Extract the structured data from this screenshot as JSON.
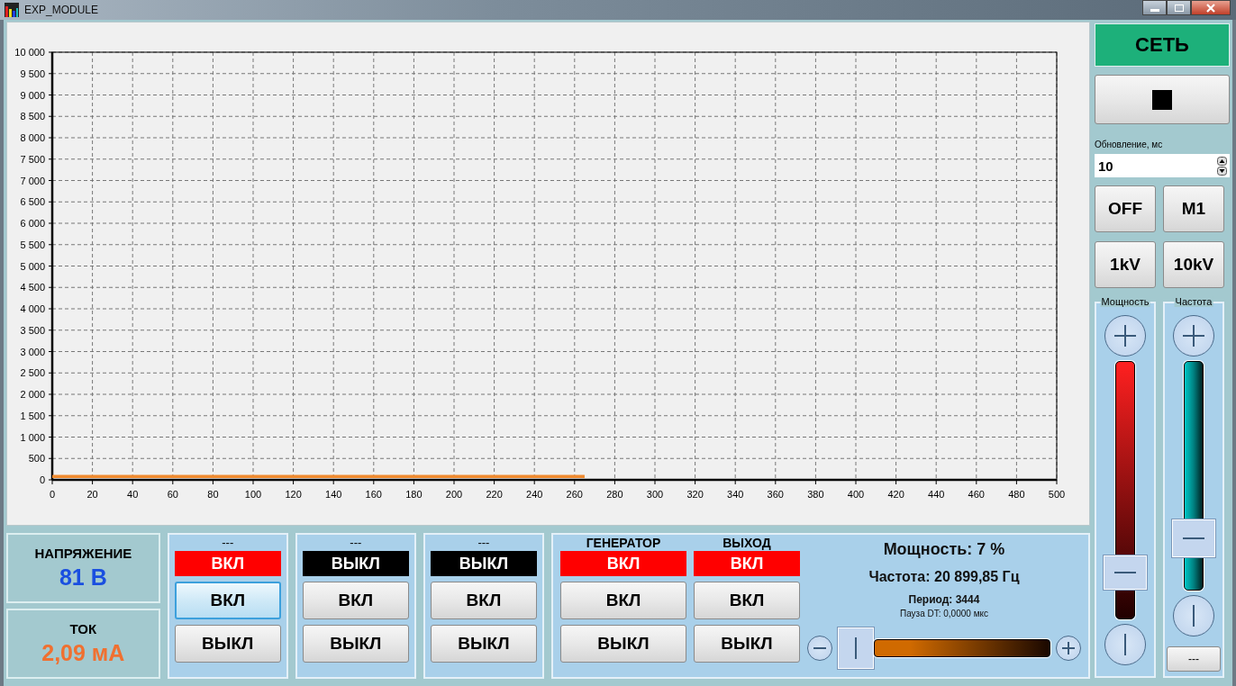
{
  "window": {
    "title": "EXP_MODULE"
  },
  "chart": {
    "chart_data": {
      "type": "line",
      "grid": true,
      "x": [
        0,
        265
      ],
      "series": [
        {
          "color": "#ef8a2f",
          "values": [
            80,
            80
          ]
        }
      ],
      "xlim": [
        0,
        500
      ],
      "ylim": [
        0,
        10000
      ],
      "xticks": [
        0,
        20,
        40,
        60,
        80,
        100,
        120,
        140,
        160,
        180,
        200,
        220,
        240,
        260,
        280,
        300,
        320,
        340,
        360,
        380,
        400,
        420,
        440,
        460,
        480,
        500
      ],
      "yticks": [
        {
          "value": 0,
          "label": "0"
        },
        {
          "value": 500,
          "label": "500"
        },
        {
          "value": 1000,
          "label": "1 000"
        },
        {
          "value": 1500,
          "label": "1 500"
        },
        {
          "value": 2000,
          "label": "2 000"
        },
        {
          "value": 2500,
          "label": "2 500"
        },
        {
          "value": 3000,
          "label": "3 000"
        },
        {
          "value": 3500,
          "label": "3 500"
        },
        {
          "value": 4000,
          "label": "4 000"
        },
        {
          "value": 4500,
          "label": "4 500"
        },
        {
          "value": 5000,
          "label": "5 000"
        },
        {
          "value": 5500,
          "label": "5 500"
        },
        {
          "value": 6000,
          "label": "6 000"
        },
        {
          "value": 6500,
          "label": "6 500"
        },
        {
          "value": 7000,
          "label": "7 000"
        },
        {
          "value": 7500,
          "label": "7 500"
        },
        {
          "value": 8000,
          "label": "8 000"
        },
        {
          "value": 8500,
          "label": "8 500"
        },
        {
          "value": 9000,
          "label": "9 000"
        },
        {
          "value": 9500,
          "label": "9 500"
        },
        {
          "value": 10000,
          "label": "10 000"
        }
      ]
    }
  },
  "sidebar": {
    "network_label": "СЕТЬ",
    "update": {
      "label": "Обновление, мс",
      "value": "10"
    },
    "mode_buttons": [
      "OFF",
      "M1",
      "1kV",
      "10kV"
    ],
    "power": {
      "title": "Мощность",
      "level": 0.13
    },
    "frequency": {
      "title": "Частота",
      "level": 0.17,
      "extra_button": "---"
    }
  },
  "readouts": [
    {
      "kind": "voltage",
      "label": "НАПРЯЖЕНИЕ",
      "value": "81 В"
    },
    {
      "kind": "current",
      "label": "ТОК",
      "value": "2,09 мА"
    }
  ],
  "channels": [
    {
      "title": "---",
      "on": true,
      "status": "ВКЛ",
      "buttons": [
        {
          "label": "ВКЛ",
          "focused": true
        },
        {
          "label": "ВЫКЛ",
          "focused": false
        }
      ]
    },
    {
      "title": "---",
      "on": false,
      "status": "ВЫКЛ",
      "buttons": [
        {
          "label": "ВКЛ",
          "focused": false
        },
        {
          "label": "ВЫКЛ",
          "focused": false
        }
      ]
    },
    {
      "title": "---",
      "on": false,
      "status": "ВЫКЛ",
      "buttons": [
        {
          "label": "ВКЛ",
          "focused": false
        },
        {
          "label": "ВЫКЛ",
          "focused": false
        }
      ]
    }
  ],
  "generator": {
    "columns": [
      {
        "title": "ГЕНЕРАТОР",
        "on": true,
        "status": "ВКЛ",
        "buttons": [
          {
            "label": "ВКЛ",
            "focused": false
          },
          {
            "label": "ВЫКЛ",
            "focused": false
          }
        ]
      },
      {
        "title": "ВЫХОД",
        "on": true,
        "status": "ВКЛ",
        "buttons": [
          {
            "label": "ВКЛ",
            "focused": false
          },
          {
            "label": "ВЫКЛ",
            "focused": false
          }
        ]
      }
    ],
    "power_text": "Мощность: 7 %",
    "frequency_text": "Частота: 20 899,85 Гц",
    "period_text": "Период: 3444",
    "pause_text": "Пауза DT: 0,0000 мкс",
    "slider": {
      "level": 0
    }
  }
}
